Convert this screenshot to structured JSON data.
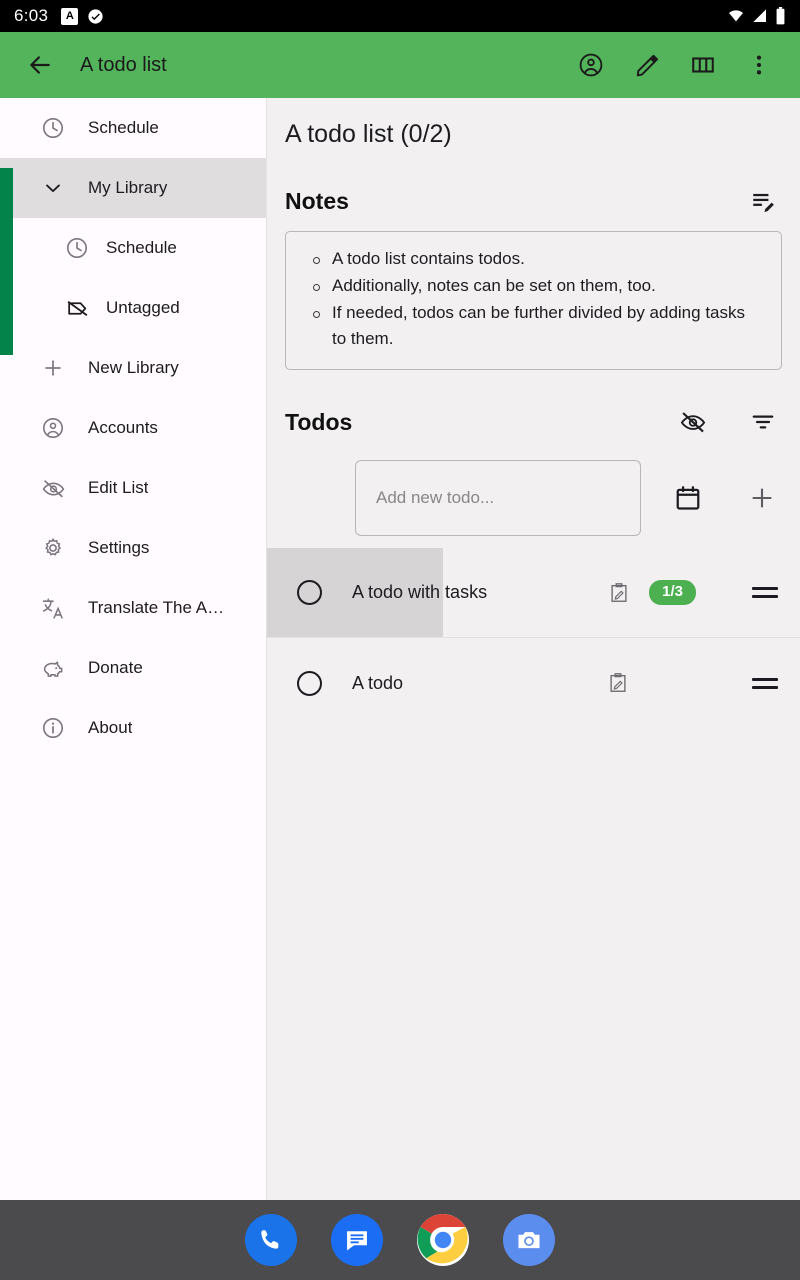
{
  "status_bar": {
    "clock": "6:03",
    "left_icons": [
      "letter-a-badge-icon",
      "check-circle-icon"
    ],
    "right_icons": [
      "wifi-icon",
      "cellular-signal-icon",
      "battery-icon"
    ]
  },
  "app_bar": {
    "back_icon": "arrow-back-icon",
    "title": "A todo list",
    "background_color": "#54b45c",
    "actions": [
      {
        "name": "account-circle-icon",
        "label": "Accounts"
      },
      {
        "name": "edit-pencil-icon",
        "label": "Edit"
      },
      {
        "name": "view-column-icon",
        "label": "Columns"
      },
      {
        "name": "more-vert-icon",
        "label": "More options"
      }
    ]
  },
  "sidebar": {
    "accent_color": "#03834a",
    "selected_background": "#e0dddf",
    "items": [
      {
        "label": "Schedule",
        "icon": "clock-icon",
        "level": "top",
        "selected": false
      },
      {
        "label": "My Library",
        "icon": "chevron-down-icon",
        "level": "top",
        "selected": true
      },
      {
        "label": "Schedule",
        "icon": "clock-icon",
        "level": "sub",
        "selected": false
      },
      {
        "label": "Untagged",
        "icon": "label-off-icon",
        "level": "sub",
        "selected": false
      },
      {
        "label": "New Library",
        "icon": "plus-icon",
        "level": "top",
        "selected": false
      },
      {
        "label": "Accounts",
        "icon": "account-circle-icon",
        "level": "top",
        "selected": false
      },
      {
        "label": "Edit List",
        "icon": "visibility-off-icon",
        "level": "top",
        "selected": false
      },
      {
        "label": "Settings",
        "icon": "gear-icon",
        "level": "top",
        "selected": false
      },
      {
        "label": "Translate The A…",
        "icon": "translate-icon",
        "level": "top",
        "selected": false
      },
      {
        "label": "Donate",
        "icon": "piggy-bank-icon",
        "level": "top",
        "selected": false
      },
      {
        "label": "About",
        "icon": "info-icon",
        "level": "top",
        "selected": false
      }
    ]
  },
  "main": {
    "list_title": "A todo list (0/2)",
    "notes_section": {
      "title": "Notes",
      "edit_icon": "edit-note-icon",
      "items": [
        "A todo list contains todos.",
        "Additionally, notes can be set on them, too.",
        "If needed, todos can be further divided by adding tasks to them."
      ]
    },
    "todos_section": {
      "title": "Todos",
      "actions": [
        {
          "name": "visibility-off-icon",
          "label": "Hide completed"
        },
        {
          "name": "filter-sort-icon",
          "label": "Sort"
        }
      ],
      "add_row": {
        "placeholder": "Add new todo...",
        "value": "",
        "calendar_icon": "calendar-icon",
        "add_icon": "plus-icon"
      },
      "items": [
        {
          "text": "A todo with tasks",
          "checked": false,
          "note_icon": "note-clipboard-icon",
          "badge": "1/3",
          "badge_color": "#4caf50",
          "drag_icon": "drag-handle-icon",
          "highlighted": true
        },
        {
          "text": "A todo",
          "checked": false,
          "note_icon": "note-clipboard-icon",
          "badge": "",
          "badge_color": "",
          "drag_icon": "drag-handle-icon",
          "highlighted": false
        }
      ]
    }
  },
  "dock": {
    "background_color": "#4b4a4d",
    "items": [
      {
        "name": "phone-icon",
        "label": "Phone"
      },
      {
        "name": "messages-icon",
        "label": "Messages"
      },
      {
        "name": "chrome-icon",
        "label": "Chrome"
      },
      {
        "name": "camera-icon",
        "label": "Camera"
      }
    ]
  }
}
